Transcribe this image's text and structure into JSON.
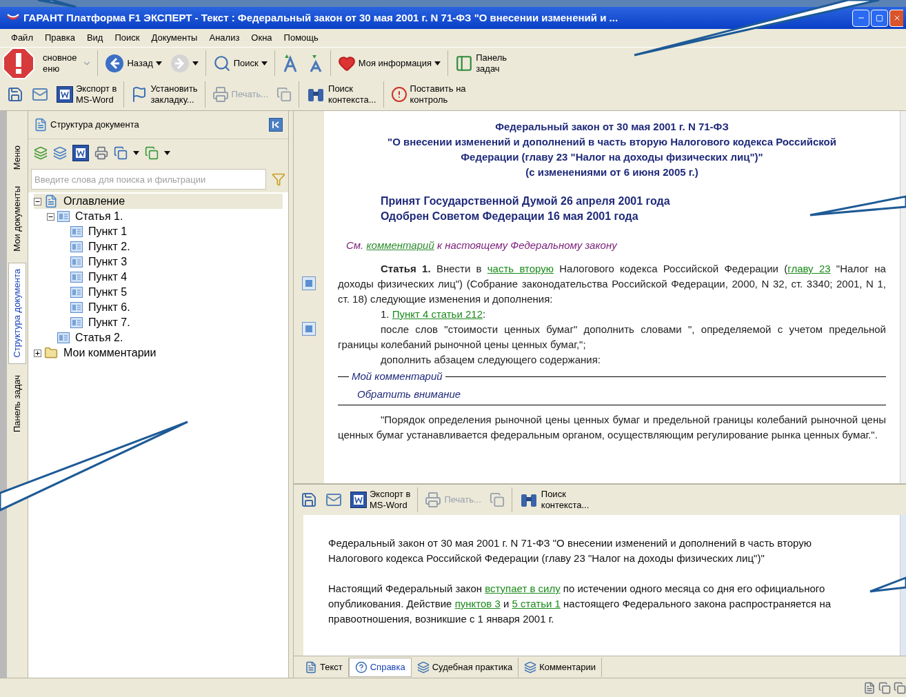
{
  "window": {
    "title": "ГАРАНТ Платформа F1 ЭКСПЕРТ - Текст : Федеральный закон от 30 мая 2001 г. N 71-ФЗ \"О внесении изменений и ..."
  },
  "menu": [
    "Файл",
    "Правка",
    "Вид",
    "Поиск",
    "Документы",
    "Анализ",
    "Окна",
    "Помощь"
  ],
  "toolbar_1": [
    {
      "lines": [
        "сновное",
        "еню"
      ]
    },
    {
      "lines": [
        "Назад"
      ]
    },
    {
      "lines": [
        "Поиск"
      ]
    },
    {
      "lines": [
        "Моя информация"
      ]
    },
    {
      "lines": [
        "Панель",
        "задач"
      ]
    }
  ],
  "toolbar_2": [
    {
      "lines": [
        "Экспорт в",
        "MS-Word"
      ],
      "disabled": false
    },
    {
      "lines": [
        "Установить",
        "закладку..."
      ],
      "disabled": false
    },
    {
      "lines": [
        "Печать..."
      ],
      "disabled": true
    },
    {
      "lines": [
        "Поиск",
        "контекста..."
      ],
      "disabled": false
    },
    {
      "lines": [
        "Поставить на",
        "контроль"
      ],
      "disabled": false
    }
  ],
  "side_tabs": [
    {
      "label": "Меню",
      "selected": false
    },
    {
      "label": "Мои документы",
      "selected": false
    },
    {
      "label": "Структура документа",
      "selected": true
    },
    {
      "label": "Панель задач",
      "selected": false
    }
  ],
  "panel": {
    "title": "Структура документа",
    "search": {
      "placeholder": "Введите слова для поиска и фильтрации"
    },
    "tree": [
      {
        "label": "Оглавление",
        "kind": "doc",
        "expanded": true,
        "selected": true,
        "children": [
          {
            "label": "Статья 1.",
            "kind": "article",
            "expanded": true,
            "selected": false,
            "children": [
              {
                "label": "Пункт 1",
                "kind": "article",
                "selected": false
              },
              {
                "label": "Пункт 2.",
                "kind": "article",
                "selected": false
              },
              {
                "label": "Пункт 3",
                "kind": "article",
                "selected": false
              },
              {
                "label": "Пункт 4",
                "kind": "article",
                "selected": false
              },
              {
                "label": "Пункт 5",
                "kind": "article",
                "selected": false
              },
              {
                "label": "Пункт 6.",
                "kind": "article",
                "selected": false
              },
              {
                "label": "Пункт 7.",
                "kind": "article",
                "selected": false
              }
            ]
          },
          {
            "label": "Статья 2.",
            "kind": "article",
            "selected": false
          }
        ]
      },
      {
        "label": "Мои комментарии",
        "kind": "folder",
        "expanded": false,
        "selected": false
      }
    ]
  },
  "document": {
    "heading": [
      "Федеральный закон от 30 мая 2001 г. N 71-ФЗ",
      "\"О внесении изменений и дополнений в часть вторую Налогового кодекса Российской Федерации (главу 23 \"Налог на доходы физических лиц\")\"",
      "(с изменениями от 6 июня 2005 г.)"
    ],
    "adopted": [
      "Принят Государственной Думой 26 апреля 2001 года",
      "Одобрен Советом Федерации 16 мая 2001 года"
    ],
    "blocks": [
      {
        "kind": "note",
        "parts": [
          {
            "text": "См. "
          },
          {
            "text": "комментарий",
            "link": true
          },
          {
            "text": " к настоящему Федеральному закону"
          }
        ]
      },
      {
        "kind": "para",
        "parts": [
          {
            "text": "Статья 1.",
            "bold": true
          },
          {
            "text": " Внести в "
          },
          {
            "text": "часть вторую",
            "link": true
          },
          {
            "text": " Налогового кодекса Российской Федерации ("
          },
          {
            "text": "главу 23",
            "link": true
          },
          {
            "text": " \"Налог на доходы физических лиц\") (Собрание законодательства Российской Федерации, 2000, N 32, ст. 3340; 2001, N 1, ст. 18) следующие изменения и дополнения:"
          }
        ]
      },
      {
        "kind": "para",
        "parts": [
          {
            "text": "1. "
          },
          {
            "text": "Пункт 4 статьи 212",
            "link": true
          },
          {
            "text": ":"
          }
        ]
      },
      {
        "kind": "para",
        "parts": [
          {
            "text": "после слов \"стоимости ценных бумаг\" дополнить словами \", определяемой с учетом предельной границы колебаний рыночной цены ценных бумаг,\";"
          }
        ]
      },
      {
        "kind": "para",
        "parts": [
          {
            "text": "дополнить абзацем следующего содержания:"
          }
        ]
      },
      {
        "kind": "comment",
        "title": "Мой комментарий",
        "text": "Обратить внимание"
      },
      {
        "kind": "para",
        "parts": [
          {
            "text": "\"Порядок определения рыночной цены ценных бумаг и предельной границы колебаний рыночной цены ценных бумаг устанавливается федеральным органом, осуществляющим регулирование рынка ценных бумаг.\"."
          }
        ]
      }
    ]
  },
  "lower_toolbar": [
    {
      "lines": [
        "Экспорт в",
        "MS-Word"
      ],
      "disabled": false
    },
    {
      "lines": [
        "Печать..."
      ],
      "disabled": true
    },
    {
      "lines": [
        "Поиск",
        "контекста..."
      ],
      "disabled": false
    }
  ],
  "reference": [
    {
      "parts": [
        {
          "text": "Федеральный закон от 30 мая 2001 г. N 71-ФЗ \"О внесении изменений и дополнений в часть вторую Налогового кодекса Российской Федерации (главу 23 \"Налог на доходы физических лиц\")\""
        }
      ]
    },
    {
      "parts": [
        {
          "text": "Настоящий Федеральный закон "
        },
        {
          "text": "вступает в силу",
          "link": true
        },
        {
          "text": " по истечении одного месяца со дня его официального опубликования. Действие "
        },
        {
          "text": "пунктов 3",
          "link": true
        },
        {
          "text": " и "
        },
        {
          "text": "5 статьи 1",
          "link": true
        },
        {
          "text": " настоящего Федерального закона распространяется на правоотношения, возникшие с 1 января 2001 г."
        }
      ]
    }
  ],
  "bottom_tabs": [
    {
      "label": "Текст",
      "selected": false
    },
    {
      "label": "Справка",
      "selected": true
    },
    {
      "label": "Судебная практика",
      "selected": false
    },
    {
      "label": "Комментарии",
      "selected": false
    }
  ]
}
